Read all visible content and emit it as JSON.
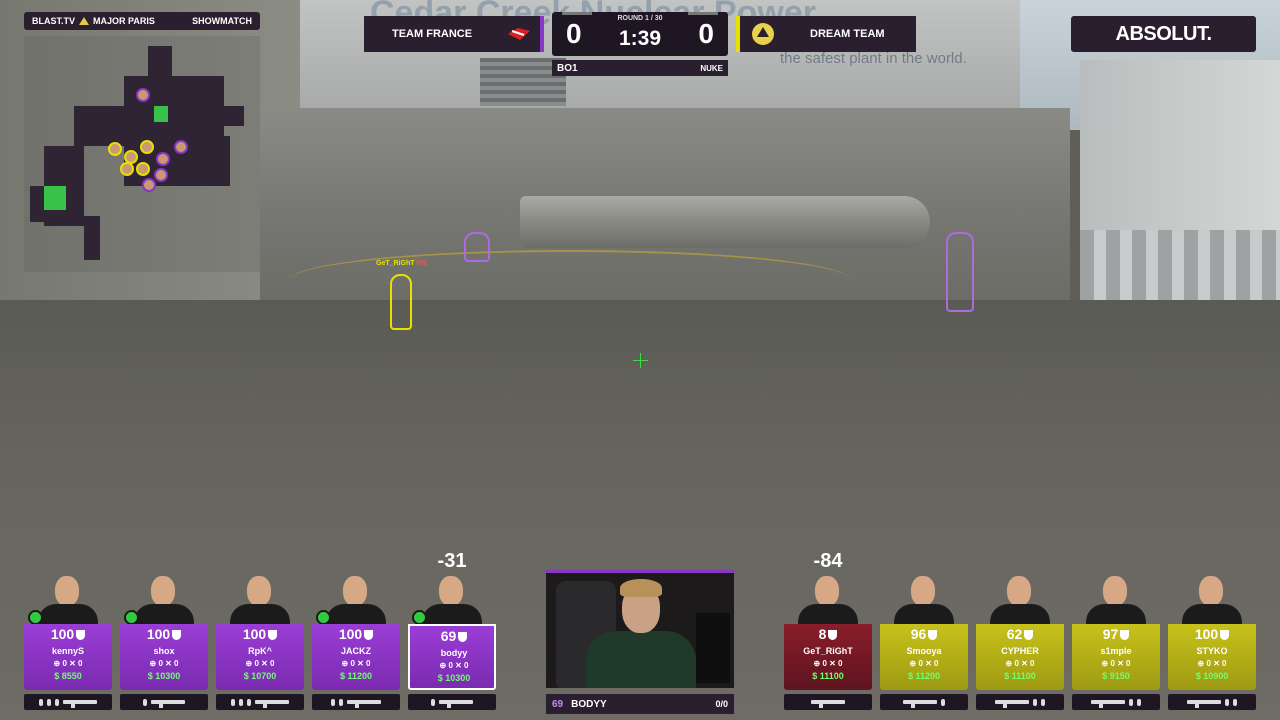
{
  "brand": {
    "left": "BLAST.TV",
    "event": "MAJOR PARIS",
    "right": "SHOWMATCH"
  },
  "background": {
    "sign_text": "Cedar Creek Nuclear Power",
    "sign_tagline": "the safest plant in the world."
  },
  "in_world_players": [
    {
      "name": "GeT_RiGhT",
      "hp_pct": "6%"
    }
  ],
  "scoreboard": {
    "team_left": "TEAM FRANCE",
    "team_right": "DREAM TEAM",
    "score_left": "0",
    "score_right": "0",
    "round": "ROUND 1 / 30",
    "timer": "1:39",
    "format": "BO1",
    "map": "NUKE",
    "colors": {
      "ct": "#8a36c7",
      "t": "#e8e000"
    }
  },
  "sponsor": {
    "label": "ABSOLUT."
  },
  "team_left_players": [
    {
      "name": "kennyS",
      "hp": "100",
      "kills": "0",
      "deaths": "0",
      "money": "$ 8550",
      "damage": ""
    },
    {
      "name": "shox",
      "hp": "100",
      "kills": "0",
      "deaths": "0",
      "money": "$ 10300",
      "damage": ""
    },
    {
      "name": "RpK^",
      "hp": "100",
      "kills": "0",
      "deaths": "0",
      "money": "$ 10700",
      "damage": ""
    },
    {
      "name": "JACKZ",
      "hp": "100",
      "kills": "0",
      "deaths": "0",
      "money": "$ 11200",
      "damage": ""
    },
    {
      "name": "bodyy",
      "hp": "69",
      "kills": "0",
      "deaths": "0",
      "money": "$ 10300",
      "damage": "-31"
    }
  ],
  "team_right_players": [
    {
      "name": "GeT_RiGhT",
      "hp": "8",
      "kills": "0",
      "deaths": "0",
      "money": "$ 11100",
      "damage": "-84"
    },
    {
      "name": "Smooya",
      "hp": "96",
      "kills": "0",
      "deaths": "0",
      "money": "$ 11200",
      "damage": ""
    },
    {
      "name": "CYPHER",
      "hp": "62",
      "kills": "0",
      "deaths": "0",
      "money": "$ 11100",
      "damage": ""
    },
    {
      "name": "s1mple",
      "hp": "97",
      "kills": "0",
      "deaths": "0",
      "money": "$ 9150",
      "damage": ""
    },
    {
      "name": "STYKO",
      "hp": "100",
      "kills": "0",
      "deaths": "0",
      "money": "$ 10900",
      "damage": ""
    }
  ],
  "camera": {
    "hp": "69",
    "player": "BODYY",
    "stats": "0/0"
  }
}
